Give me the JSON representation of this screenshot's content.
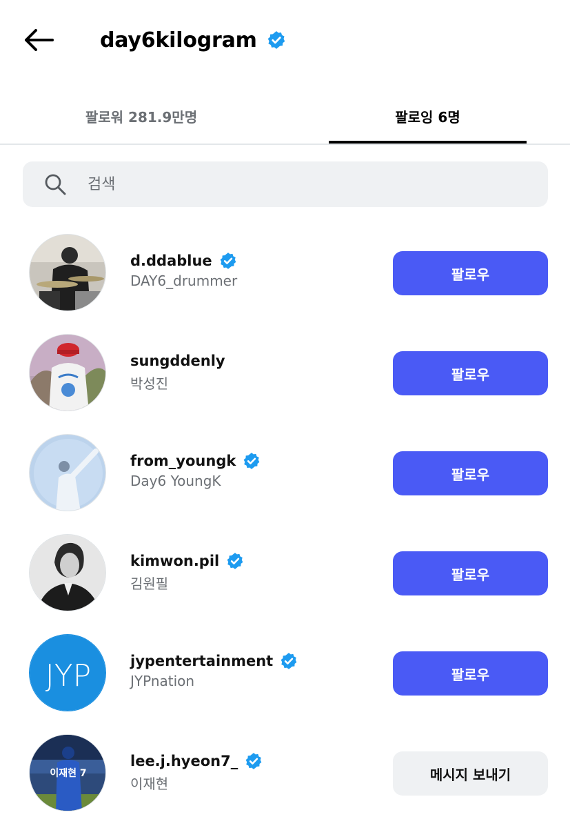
{
  "header": {
    "title": "day6kilogram",
    "verified": true
  },
  "tabs": {
    "followers_label": "팔로워 281.9만명",
    "following_label": "팔로잉 6명"
  },
  "search": {
    "placeholder": "검색"
  },
  "colors": {
    "follow_button": "#4a5af5",
    "verified_badge": "#1d9bf0",
    "secondary_text": "#6b6f74"
  },
  "users": [
    {
      "username": "d.ddablue",
      "subname": "DAY6_drummer",
      "verified": true,
      "button": "팔로우"
    },
    {
      "username": "sungddenly",
      "subname": "박성진",
      "verified": false,
      "button": "팔로우"
    },
    {
      "username": "from_youngk",
      "subname": "Day6 YoungK",
      "verified": true,
      "button": "팔로우"
    },
    {
      "username": "kimwon.pil",
      "subname": "김원필",
      "verified": true,
      "button": "팔로우"
    },
    {
      "username": "jypentertainment",
      "subname": "JYPnation",
      "verified": true,
      "button": "팔로우",
      "avatar_text": "JYP"
    },
    {
      "username": "lee.j.hyeon7_",
      "subname": "이재현",
      "verified": true,
      "button": "메시지 보내기",
      "avatar_text": "이재현 7"
    }
  ]
}
